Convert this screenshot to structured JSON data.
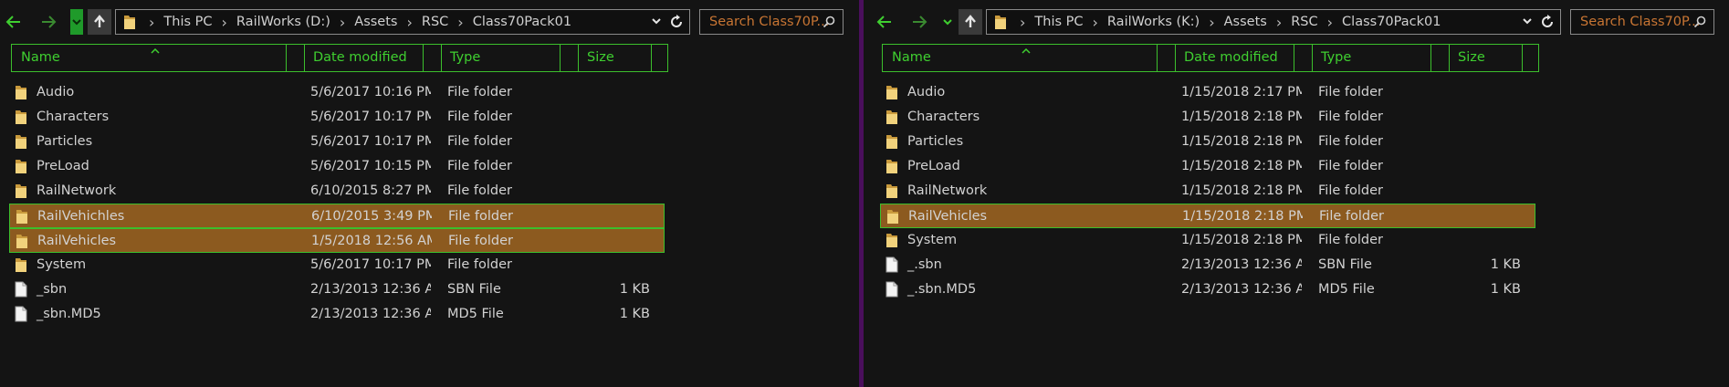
{
  "panes": [
    {
      "id": "left",
      "path": [
        "This PC",
        "RailWorks (D:)",
        "Assets",
        "RSC",
        "Class70Pack01"
      ],
      "search_placeholder": "Search Class70P...",
      "columns": [
        "Name",
        "Date modified",
        "Type",
        "Size"
      ],
      "rows": [
        {
          "name": "Audio",
          "date": "5/6/2017 10:16 PM",
          "type": "File folder",
          "size": "",
          "icon": "folder-icon",
          "selected": false
        },
        {
          "name": "Characters",
          "date": "5/6/2017 10:17 PM",
          "type": "File folder",
          "size": "",
          "icon": "folder-icon",
          "selected": false
        },
        {
          "name": "Particles",
          "date": "5/6/2017 10:17 PM",
          "type": "File folder",
          "size": "",
          "icon": "folder-icon",
          "selected": false
        },
        {
          "name": "PreLoad",
          "date": "5/6/2017 10:15 PM",
          "type": "File folder",
          "size": "",
          "icon": "folder-icon",
          "selected": false
        },
        {
          "name": "RailNetwork",
          "date": "6/10/2015 8:27 PM",
          "type": "File folder",
          "size": "",
          "icon": "folder-icon",
          "selected": false
        },
        {
          "name": "RailVehichles",
          "date": "6/10/2015 3:49 PM",
          "type": "File folder",
          "size": "",
          "icon": "folder-icon",
          "selected": true
        },
        {
          "name": "RailVehicles",
          "date": "1/5/2018 12:56 AM",
          "type": "File folder",
          "size": "",
          "icon": "folder-icon",
          "selected": true
        },
        {
          "name": "System",
          "date": "5/6/2017 10:17 PM",
          "type": "File folder",
          "size": "",
          "icon": "folder-icon",
          "selected": false
        },
        {
          "name": "_sbn",
          "date": "2/13/2013 12:36 A...",
          "type": "SBN File",
          "size": "1 KB",
          "icon": "file-icon",
          "selected": false
        },
        {
          "name": "_sbn.MD5",
          "date": "2/13/2013 12:36 A...",
          "type": "MD5 File",
          "size": "1 KB",
          "icon": "file-icon",
          "selected": false
        }
      ]
    },
    {
      "id": "right",
      "path": [
        "This PC",
        "RailWorks (K:)",
        "Assets",
        "RSC",
        "Class70Pack01"
      ],
      "search_placeholder": "Search Class70P...",
      "columns": [
        "Name",
        "Date modified",
        "Type",
        "Size"
      ],
      "rows": [
        {
          "name": "Audio",
          "date": "1/15/2018 2:17 PM",
          "type": "File folder",
          "size": "",
          "icon": "folder-icon",
          "selected": false
        },
        {
          "name": "Characters",
          "date": "1/15/2018 2:18 PM",
          "type": "File folder",
          "size": "",
          "icon": "folder-icon",
          "selected": false
        },
        {
          "name": "Particles",
          "date": "1/15/2018 2:18 PM",
          "type": "File folder",
          "size": "",
          "icon": "folder-icon",
          "selected": false
        },
        {
          "name": "PreLoad",
          "date": "1/15/2018 2:18 PM",
          "type": "File folder",
          "size": "",
          "icon": "folder-icon",
          "selected": false
        },
        {
          "name": "RailNetwork",
          "date": "1/15/2018 2:18 PM",
          "type": "File folder",
          "size": "",
          "icon": "folder-icon",
          "selected": false
        },
        {
          "name": "RailVehicles",
          "date": "1/15/2018 2:18 PM",
          "type": "File folder",
          "size": "",
          "icon": "folder-icon",
          "selected": true
        },
        {
          "name": "System",
          "date": "1/15/2018 2:18 PM",
          "type": "File folder",
          "size": "",
          "icon": "folder-icon",
          "selected": false
        },
        {
          "name": "_.sbn",
          "date": "2/13/2013 12:36 A...",
          "type": "SBN File",
          "size": "1 KB",
          "icon": "file-icon",
          "selected": false
        },
        {
          "name": "_.sbn.MD5",
          "date": "2/13/2013 12:36 A...",
          "type": "MD5 File",
          "size": "1 KB",
          "icon": "file-icon",
          "selected": false
        }
      ]
    }
  ],
  "colors": {
    "background": "#141414",
    "accent_green": "#3fcf30",
    "selection_fill": "#8c5a1f",
    "search_placeholder": "#c87533",
    "divider": "#3a0a4a"
  }
}
